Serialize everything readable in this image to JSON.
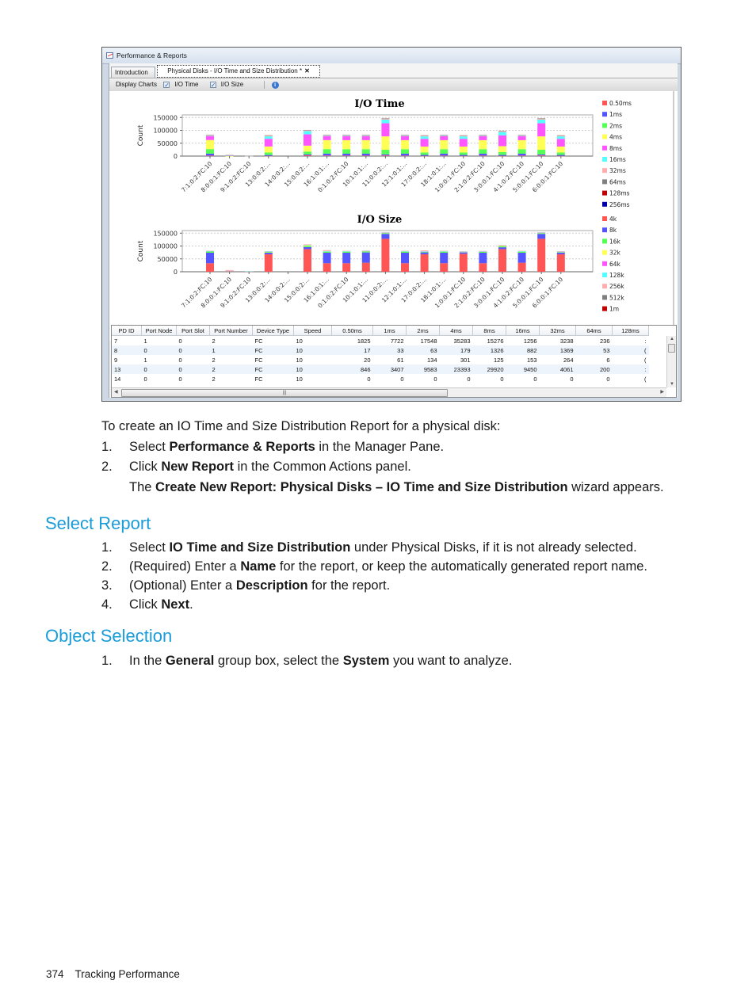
{
  "window": {
    "title": "Performance & Reports",
    "tabs": [
      {
        "label": "Introduction",
        "active": false
      },
      {
        "label": "Physical Disks - I/O Time and Size Distribution *",
        "active": true
      }
    ],
    "toolbar": {
      "display_charts_label": "Display Charts",
      "io_time_label": "I/O Time",
      "io_time_checked": true,
      "io_size_label": "I/O Size",
      "io_size_checked": true,
      "info_icon": "info-icon"
    }
  },
  "chart_data": [
    {
      "type": "bar",
      "stacked": true,
      "title": "I/O Time",
      "xlabel": "",
      "ylabel": "Count",
      "ylim": [
        0,
        160000
      ],
      "yticks": [
        0,
        50000,
        100000,
        150000
      ],
      "grid": true,
      "legend_position": "right",
      "categories": [
        "7:1:0:2:FC:10",
        "8:0:0:1:FC:10",
        "9:1:0:2:FC:10",
        "13:0:0:2:...",
        "14:0:0:2:...",
        "15:0:0:2:...",
        "16:1:0:1:...",
        "0:1:0:2:FC:10",
        "10:1:0:1:...",
        "11:0:0:2:...",
        "12:1:0:1:...",
        "17:0:0:2:...",
        "18:1:0:1:...",
        "1:0:0:1:FC:10",
        "2:1:0:2:FC:10",
        "3:0:0:1:FC:10",
        "4:1:0:2:FC:10",
        "5:0:0:1:FC:10",
        "6:0:0:1:FC:10"
      ],
      "series": [
        {
          "name": "0.50ms",
          "color": "#ff5555",
          "values": [
            1825,
            17,
            20,
            846,
            0,
            3000,
            2000,
            1800,
            1800,
            2500,
            1800,
            1000,
            1800,
            1000,
            1800,
            1000,
            1800,
            2500,
            1000
          ]
        },
        {
          "name": "1ms",
          "color": "#5555ff",
          "values": [
            7722,
            33,
            61,
            3407,
            0,
            3500,
            7500,
            7500,
            7500,
            4000,
            7500,
            3500,
            7500,
            3500,
            7500,
            3500,
            7500,
            4000,
            3500
          ]
        },
        {
          "name": "2ms",
          "color": "#55ff55",
          "values": [
            17548,
            63,
            134,
            9583,
            0,
            11000,
            17500,
            17500,
            17500,
            18000,
            17500,
            9500,
            17500,
            9500,
            17500,
            11000,
            17500,
            18000,
            9500
          ]
        },
        {
          "name": "4ms",
          "color": "#ffff55",
          "values": [
            35283,
            179,
            301,
            23393,
            0,
            23000,
            35000,
            35000,
            35000,
            52000,
            35000,
            23000,
            35000,
            23000,
            35000,
            23000,
            35000,
            52000,
            23000
          ]
        },
        {
          "name": "8ms",
          "color": "#ff55ff",
          "values": [
            15276,
            1326,
            125,
            29920,
            0,
            44000,
            15500,
            15500,
            15500,
            51000,
            15500,
            30000,
            15500,
            30000,
            15500,
            42000,
            15500,
            51000,
            30000
          ]
        },
        {
          "name": "16ms",
          "color": "#55ffff",
          "values": [
            1256,
            882,
            153,
            9450,
            0,
            13000,
            1300,
            1300,
            1300,
            14000,
            1300,
            9500,
            1300,
            9500,
            1300,
            13000,
            1300,
            14000,
            9500
          ]
        },
        {
          "name": "32ms",
          "color": "#ffafaf",
          "values": [
            3238,
            1369,
            264,
            4061,
            0,
            4000,
            3200,
            3200,
            3200,
            5000,
            3200,
            4000,
            3200,
            4000,
            3200,
            4000,
            3200,
            5000,
            4000
          ]
        },
        {
          "name": "64ms",
          "color": "#808080",
          "values": [
            236,
            53,
            6,
            200,
            0,
            200,
            236,
            236,
            236,
            300,
            236,
            200,
            236,
            200,
            236,
            200,
            236,
            300,
            200
          ]
        },
        {
          "name": "128ms",
          "color": "#c00000",
          "values": [
            0,
            0,
            0,
            0,
            0,
            0,
            0,
            0,
            0,
            0,
            0,
            0,
            0,
            0,
            0,
            0,
            0,
            0,
            0
          ]
        },
        {
          "name": "256ms",
          "color": "#0000aa",
          "values": [
            0,
            0,
            0,
            0,
            0,
            0,
            0,
            0,
            0,
            0,
            0,
            0,
            0,
            0,
            0,
            0,
            0,
            0,
            0
          ]
        }
      ]
    },
    {
      "type": "bar",
      "stacked": true,
      "title": "I/O Size",
      "xlabel": "",
      "ylabel": "Count",
      "ylim": [
        0,
        160000
      ],
      "yticks": [
        0,
        50000,
        100000,
        150000
      ],
      "grid": true,
      "legend_position": "right",
      "categories": [
        "7:1:0:2:FC:10",
        "8:0:0:1:FC:10",
        "9:1:0:2:FC:10",
        "13:0:0:2:...",
        "14:0:0:2:...",
        "15:0:0:2:...",
        "16:1:0:1:...",
        "0:1:0:2:FC:10",
        "10:1:0:1:...",
        "11:0:0:2:...",
        "12:1:0:1:...",
        "17:0:0:2:...",
        "18:1:0:1:...",
        "1:0:0:1:FC:10",
        "2:1:0:2:FC:10",
        "3:0:0:1:FC:10",
        "4:1:0:2:FC:10",
        "5:0:0:1:FC:10",
        "6:0:0:1:FC:10"
      ],
      "series": [
        {
          "name": "4k",
          "color": "#ff5555",
          "values": [
            33000,
            2500,
            1000,
            68000,
            0,
            88000,
            33000,
            33000,
            35000,
            128000,
            33000,
            68000,
            33000,
            70000,
            33000,
            88000,
            35000,
            128000,
            68000
          ]
        },
        {
          "name": "8k",
          "color": "#5555ff",
          "values": [
            41000,
            500,
            300,
            6000,
            0,
            8000,
            41000,
            41000,
            40000,
            19000,
            41000,
            7000,
            41000,
            5000,
            41000,
            7000,
            39000,
            19000,
            6000
          ]
        },
        {
          "name": "16k",
          "color": "#55ff55",
          "values": [
            5000,
            300,
            100,
            2500,
            0,
            4000,
            4000,
            4000,
            4000,
            3000,
            4000,
            2000,
            4000,
            1500,
            4000,
            3500,
            4000,
            3000,
            2000
          ]
        },
        {
          "name": "32k",
          "color": "#ffff55",
          "values": [
            1000,
            200,
            100,
            1500,
            0,
            4000,
            1500,
            1500,
            1500,
            1500,
            1500,
            1500,
            1500,
            1000,
            1000,
            3500,
            1500,
            1500,
            1500
          ]
        },
        {
          "name": "64k",
          "color": "#ff55ff",
          "values": [
            300,
            100,
            50,
            300,
            0,
            400,
            300,
            300,
            300,
            300,
            300,
            300,
            300,
            300,
            300,
            400,
            300,
            300,
            300
          ]
        },
        {
          "name": "128k",
          "color": "#55ffff",
          "values": [
            200,
            100,
            50,
            200,
            0,
            300,
            200,
            200,
            200,
            200,
            200,
            200,
            200,
            200,
            200,
            300,
            200,
            200,
            200
          ]
        },
        {
          "name": "256k",
          "color": "#ffafaf",
          "values": [
            1500,
            3000,
            1500,
            1500,
            0,
            2000,
            4000,
            1500,
            1500,
            1500,
            1500,
            4000,
            1500,
            1500,
            1500,
            1500,
            1500,
            1500,
            2000
          ]
        },
        {
          "name": "512k",
          "color": "#808080",
          "values": [
            0,
            0,
            0,
            0,
            0,
            0,
            0,
            0,
            0,
            0,
            0,
            0,
            0,
            0,
            0,
            0,
            0,
            0,
            0
          ]
        },
        {
          "name": "1m",
          "color": "#c00000",
          "values": [
            0,
            0,
            0,
            0,
            0,
            0,
            0,
            0,
            0,
            0,
            0,
            0,
            0,
            0,
            0,
            0,
            0,
            0,
            0
          ]
        }
      ]
    }
  ],
  "table": {
    "columns": [
      "PD ID",
      "Port Node",
      "Port Slot",
      "Port Number",
      "Device Type",
      "Speed",
      "0.50ms",
      "1ms",
      "2ms",
      "4ms",
      "8ms",
      "16ms",
      "32ms",
      "64ms",
      "128ms"
    ],
    "rows": [
      [
        "7",
        "1",
        "0",
        "2",
        "FC",
        "10",
        "1825",
        "7722",
        "17548",
        "35283",
        "15276",
        "1256",
        "3238",
        "236",
        ":"
      ],
      [
        "8",
        "0",
        "0",
        "1",
        "FC",
        "10",
        "17",
        "33",
        "63",
        "179",
        "1326",
        "882",
        "1369",
        "53",
        "("
      ],
      [
        "9",
        "1",
        "0",
        "2",
        "FC",
        "10",
        "20",
        "61",
        "134",
        "301",
        "125",
        "153",
        "264",
        "6",
        "("
      ],
      [
        "13",
        "0",
        "0",
        "2",
        "FC",
        "10",
        "846",
        "3407",
        "9583",
        "23393",
        "29920",
        "9450",
        "4061",
        "200",
        ":"
      ],
      [
        "14",
        "0",
        "0",
        "2",
        "FC",
        "10",
        "0",
        "0",
        "0",
        "0",
        "0",
        "0",
        "0",
        "0",
        "("
      ]
    ]
  },
  "document": {
    "intro": "To create an IO Time and Size Distribution Report for a physical disk:",
    "steps": [
      {
        "num": "1.",
        "pre": "Select ",
        "bold": "Performance & Reports",
        "post": " in the Manager Pane."
      },
      {
        "num": "2.",
        "pre": "Click ",
        "bold": "New Report",
        "post": " in the Common Actions panel."
      }
    ],
    "step2_note": {
      "pre": "The ",
      "bold": "Create New Report: Physical Disks – IO Time and Size Distribution",
      "post": " wizard appears."
    },
    "sections": [
      {
        "heading": "Select Report",
        "steps": [
          {
            "num": "1.",
            "pre": "Select ",
            "bold": "IO Time and Size Distribution",
            "post": " under Physical Disks, if it is not already selected."
          },
          {
            "num": "2.",
            "pre": "(Required) Enter a ",
            "bold": "Name",
            "post": " for the report, or keep the automatically generated report name."
          },
          {
            "num": "3.",
            "pre": "(Optional) Enter a ",
            "bold": "Description",
            "post": " for the report."
          },
          {
            "num": "4.",
            "pre": "Click ",
            "bold": "Next",
            "post": "."
          }
        ]
      },
      {
        "heading": "Object Selection",
        "steps": [
          {
            "num": "1.",
            "pre": "In the ",
            "bold": "General",
            "mid": " group box, select the ",
            "bold2": "System",
            "post": " you want to analyze."
          }
        ]
      }
    ]
  },
  "footer": {
    "page_number": "374",
    "section": "Tracking Performance"
  }
}
